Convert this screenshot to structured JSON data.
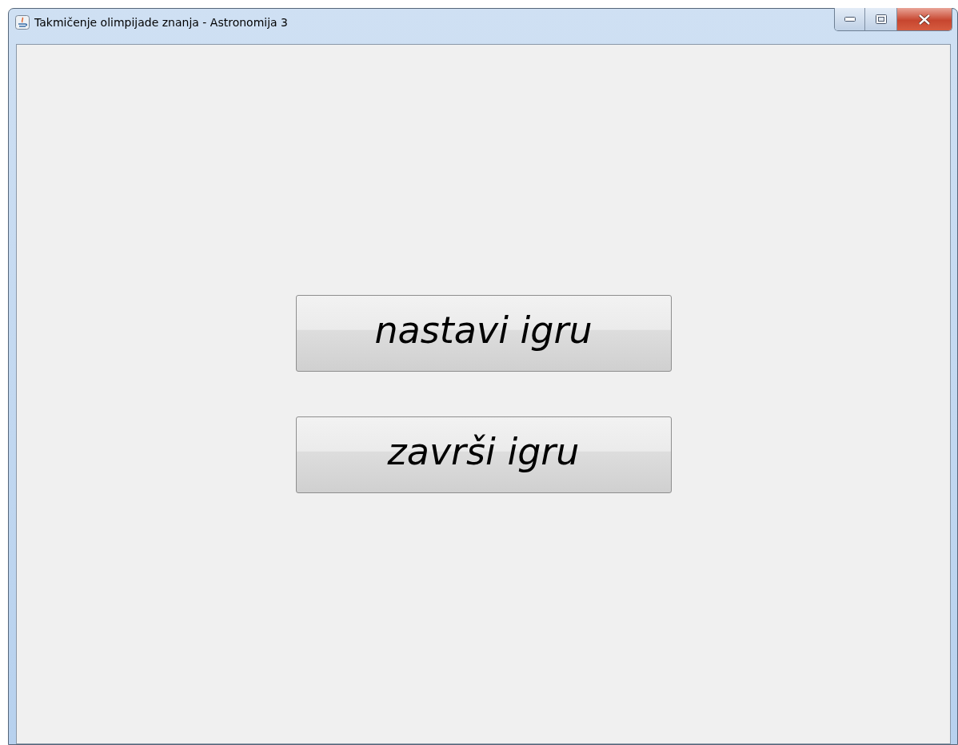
{
  "window": {
    "title": "Takmičenje olimpijade znanja - Astronomija 3"
  },
  "buttons": [
    {
      "label": "nastavi igru"
    },
    {
      "label": "završi igru"
    }
  ]
}
